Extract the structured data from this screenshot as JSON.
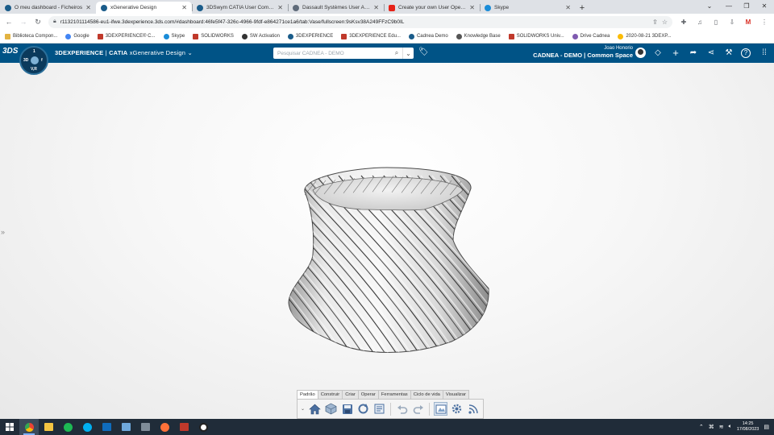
{
  "browser": {
    "tabs": [
      {
        "title": "O meu dashboard - Ficheiros",
        "color": "#1a5c8a",
        "active": false
      },
      {
        "title": "xGenerative Design",
        "color": "#1a5c8a",
        "active": true
      },
      {
        "title": "3DSwym CATIA User Community",
        "color": "#1a5c8a",
        "active": false
      },
      {
        "title": "Dassault Systèmes User Assistan...",
        "color": "#5f6b7a",
        "active": false
      },
      {
        "title": "Create your own User Operators",
        "color": "#e62117",
        "active": false
      },
      {
        "title": "Skype",
        "color": "#1a8cd8",
        "active": false
      }
    ],
    "new_tab": "+",
    "window": {
      "minimize": "—",
      "maximize": "❐",
      "close": "✕",
      "chevron": "⌄"
    },
    "url": "r1132101114586-eu1-ifwe.3dexperience.3ds.com/#dashboard:46fe5f47-326c-4966-9fdf-e864271ce1a6/tab:Vase/fullscreen:9sKsv38A249FFzC9b0IL",
    "bookmarks": [
      {
        "label": "Biblioteca Compon...",
        "color": "#e3b341"
      },
      {
        "label": "Google",
        "color": "#4285f4"
      },
      {
        "label": "3DEXPERIENCE® C...",
        "color": "#c0392b"
      },
      {
        "label": "Skype",
        "color": "#1a8cd8"
      },
      {
        "label": "SOLIDWORKS",
        "color": "#c0392b"
      },
      {
        "label": "SW Activation",
        "color": "#333333"
      },
      {
        "label": "3DEXPERIENCE",
        "color": "#1a5c8a"
      },
      {
        "label": "3DEXPERIENCE Edu...",
        "color": "#c0392b"
      },
      {
        "label": "Cadnea Demo",
        "color": "#1a5c8a"
      },
      {
        "label": "Knowledge Base",
        "color": "#555555"
      },
      {
        "label": "SOLIDWORKS Univ...",
        "color": "#c0392b"
      },
      {
        "label": "Drive Cadnea",
        "color": "#7f5ab0"
      },
      {
        "label": "2020-08-21 3DEXP...",
        "color": "#fbbc05"
      }
    ]
  },
  "app": {
    "brand_bold": "3DEXPERIENCE",
    "brand_sep": " | ",
    "brand_product": "CATIA",
    "brand_app": " xGenerative Design",
    "compass": {
      "tl": "3D",
      "tr": "f",
      "bl": "V,R",
      "br": "1"
    },
    "search_placeholder": "Pesquisar CADNEA - DEMO",
    "user_name": "Joao Honorio",
    "space": "CADNEA - DEMO | Common Space"
  },
  "action_bar": {
    "tabs": [
      "Padrão",
      "Construir",
      "Criar",
      "Operar",
      "Ferramentas",
      "Ciclo de vida",
      "Visualizar"
    ],
    "active_tab": "Padrão"
  },
  "taskbar": {
    "time": "14:25",
    "date": "17/08/2023"
  }
}
